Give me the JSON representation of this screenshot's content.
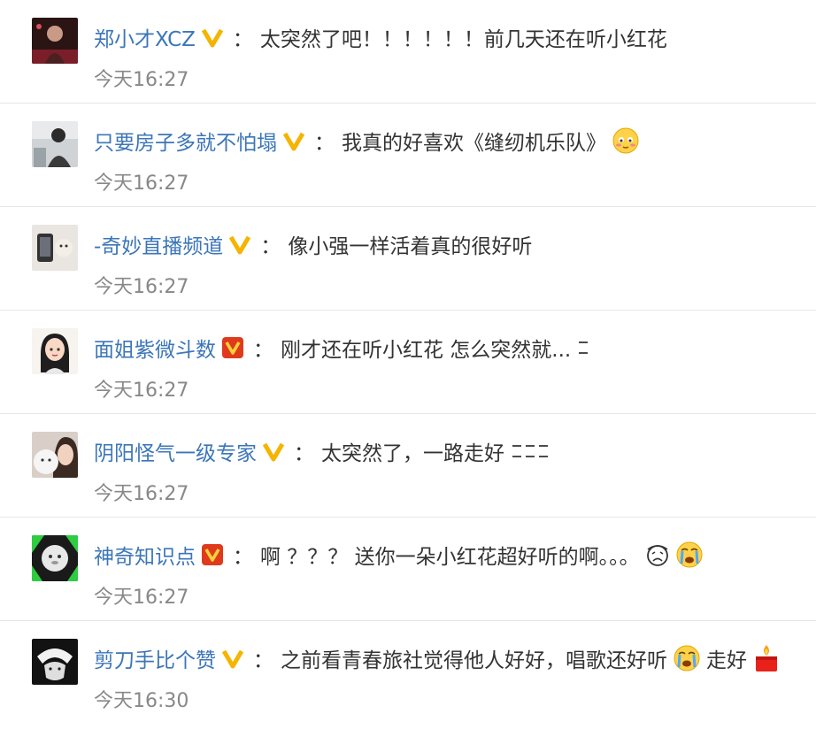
{
  "comments": [
    {
      "user": "郑小才XCZ",
      "badge": "yellow",
      "separator": "：",
      "text": "太突然了吧！！！！！！前几天还在听小红花",
      "time": "今天16:27"
    },
    {
      "user": "只要房子多就不怕塌",
      "badge": "yellow",
      "separator": "：",
      "text": "我真的好喜欢《缝纫机乐队》",
      "emoji": [
        "blush-face-icon"
      ],
      "time": "今天16:27"
    },
    {
      "user": "-奇妙直播频道",
      "badge": "yellow",
      "separator": "：",
      "text": "像小强一样活着真的很好听",
      "time": "今天16:27"
    },
    {
      "user": "面姐紫微斗数",
      "badge": "red",
      "separator": "：",
      "text": "刚才还在听小红花 怎么突然就...",
      "time": "今天16:27"
    },
    {
      "user": "阴阳怪气一级专家",
      "badge": "yellow",
      "separator": "：",
      "text": "太突然了，一路走好",
      "time": "今天16:27"
    },
    {
      "user": "神奇知识点",
      "badge": "red",
      "separator": "：",
      "text": "啊 ？？？ 送你一朵小红花超好听的啊。。。",
      "emoji": [
        "sad-face-icon",
        "crying-face-icon"
      ],
      "time": "今天16:27"
    },
    {
      "user": "剪刀手比个赞",
      "badge": "yellow",
      "separator": "：",
      "text": "之前看青春旅社觉得他人好好，唱歌还好听",
      "text2": "走好",
      "emoji": [
        "crying-face-icon"
      ],
      "emoji2": [
        "candle-icon"
      ],
      "time": "今天16:30"
    }
  ],
  "colors": {
    "username": "#3b76b8",
    "text": "#333333",
    "time": "#888888",
    "badge_yellow": "#f5b400",
    "badge_red": "#e03a1c",
    "divider": "#e6e6e6"
  }
}
